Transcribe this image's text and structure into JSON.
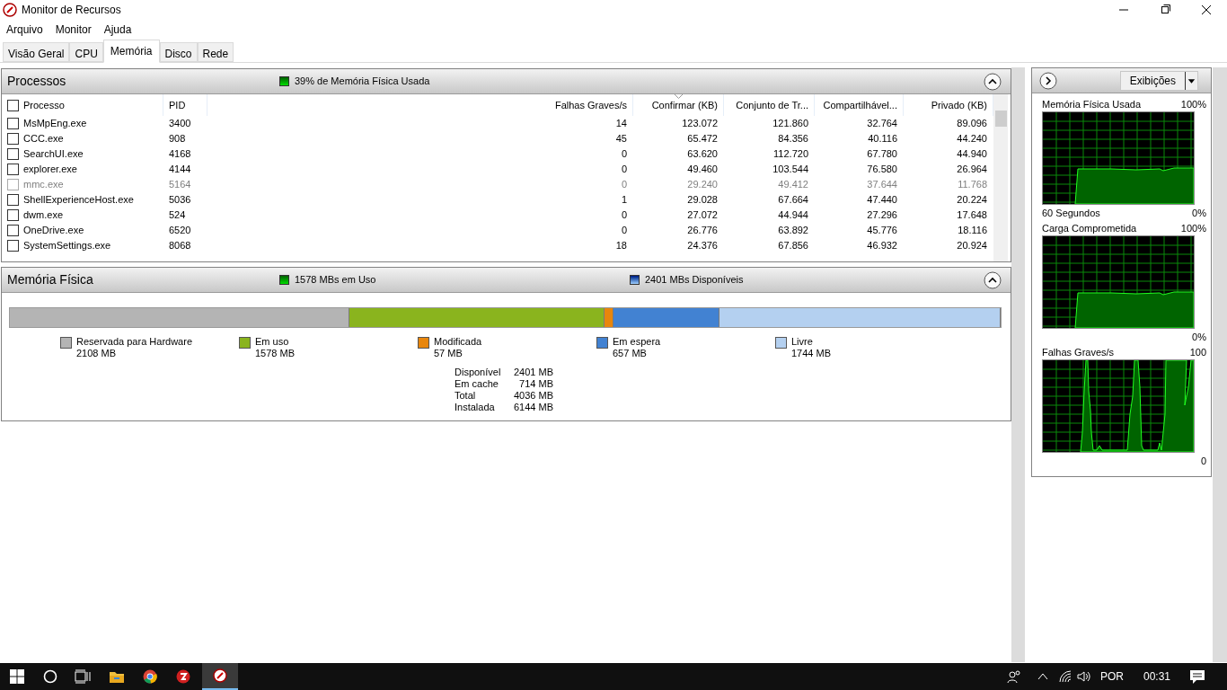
{
  "window": {
    "title": "Monitor de Recursos"
  },
  "menu": [
    "Arquivo",
    "Monitor",
    "Ajuda"
  ],
  "tabs": [
    {
      "label": "Visão Geral",
      "selected": false
    },
    {
      "label": "CPU",
      "selected": false
    },
    {
      "label": "Memória",
      "selected": true
    },
    {
      "label": "Disco",
      "selected": false
    },
    {
      "label": "Rede",
      "selected": false
    }
  ],
  "processes": {
    "title": "Processos",
    "summary": "39% de Memória Física Usada",
    "expanded": true,
    "columns": [
      {
        "label": "Processo",
        "sorted": false
      },
      {
        "label": "PID",
        "sorted": false
      },
      {
        "label": "Falhas Graves/s",
        "sorted": false
      },
      {
        "label": "Confirmar (KB)",
        "sorted": true
      },
      {
        "label": "Conjunto de Tr...",
        "sorted": false
      },
      {
        "label": "Compartilhável...",
        "sorted": false
      },
      {
        "label": "Privado (KB)",
        "sorted": false
      }
    ],
    "header_checked": false,
    "rows": [
      {
        "checked": false,
        "disabled": false,
        "cells": [
          "MsMpEng.exe",
          "3400",
          "14",
          "123.072",
          "121.860",
          "32.764",
          "89.096"
        ]
      },
      {
        "checked": false,
        "disabled": false,
        "cells": [
          "CCC.exe",
          "908",
          "45",
          "65.472",
          "84.356",
          "40.116",
          "44.240"
        ]
      },
      {
        "checked": false,
        "disabled": false,
        "cells": [
          "SearchUI.exe",
          "4168",
          "0",
          "63.620",
          "112.720",
          "67.780",
          "44.940"
        ]
      },
      {
        "checked": false,
        "disabled": false,
        "cells": [
          "explorer.exe",
          "4144",
          "0",
          "49.460",
          "103.544",
          "76.580",
          "26.964"
        ]
      },
      {
        "checked": false,
        "disabled": true,
        "cells": [
          "mmc.exe",
          "5164",
          "0",
          "29.240",
          "49.412",
          "37.644",
          "11.768"
        ]
      },
      {
        "checked": false,
        "disabled": false,
        "cells": [
          "ShellExperienceHost.exe",
          "5036",
          "1",
          "29.028",
          "67.664",
          "47.440",
          "20.224"
        ]
      },
      {
        "checked": false,
        "disabled": false,
        "cells": [
          "dwm.exe",
          "524",
          "0",
          "27.072",
          "44.944",
          "27.296",
          "17.648"
        ]
      },
      {
        "checked": false,
        "disabled": false,
        "cells": [
          "OneDrive.exe",
          "6520",
          "0",
          "26.776",
          "63.892",
          "45.776",
          "18.116"
        ]
      },
      {
        "checked": false,
        "disabled": false,
        "cells": [
          "SystemSettings.exe",
          "8068",
          "18",
          "24.376",
          "67.856",
          "46.932",
          "20.924"
        ]
      }
    ]
  },
  "physical_memory": {
    "title": "Memória Física",
    "in_use": "1578 MBs em Uso",
    "available": "2401 MBs Disponíveis",
    "expanded": true,
    "segments": [
      {
        "label": "Reservada para Hardware",
        "value": "2108 MB",
        "color": "#b4b4b4"
      },
      {
        "label": "Em uso",
        "value": "1578 MB",
        "color": "#8ab41e"
      },
      {
        "label": "Modificada",
        "value": "57 MB",
        "color": "#e8860c"
      },
      {
        "label": "Em espera",
        "value": "657 MB",
        "color": "#4282d2"
      },
      {
        "label": "Livre",
        "value": "1744 MB",
        "color": "#b4d0f0"
      }
    ],
    "totals": [
      {
        "label": "Disponível",
        "value": "2401 MB"
      },
      {
        "label": "Em cache",
        "value": "714 MB"
      },
      {
        "label": "Total",
        "value": "4036 MB"
      },
      {
        "label": "Instalada",
        "value": "6144 MB"
      }
    ]
  },
  "graphs_panel": {
    "views_button": "Exibições",
    "graphs": [
      {
        "title": "Memória Física Usada",
        "max": "100%",
        "min": "0%",
        "time": "60 Segundos",
        "kind": "flat"
      },
      {
        "title": "Carga Comprometida",
        "max": "100%",
        "min": "0%",
        "kind": "flat"
      },
      {
        "title": "Falhas Graves/s",
        "max": "100",
        "min": "0",
        "kind": "spiky"
      }
    ]
  },
  "taskbar": {
    "language": "POR",
    "time": "00:31"
  }
}
